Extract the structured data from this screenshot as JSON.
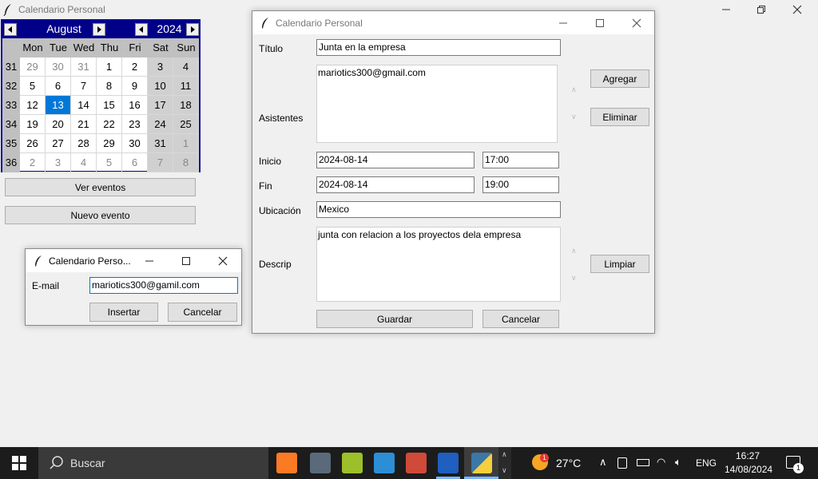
{
  "main_window": {
    "title": "Calendario Personal",
    "controls": {
      "minimize": "—",
      "restore": "❐",
      "close": "✕"
    }
  },
  "calendar": {
    "month": "August",
    "year": "2024",
    "weekdays": [
      "Mon",
      "Tue",
      "Wed",
      "Thu",
      "Fri",
      "Sat",
      "Sun"
    ],
    "weeks": [
      {
        "num": "31",
        "days": [
          "29",
          "30",
          "31",
          "1",
          "2",
          "3",
          "4"
        ]
      },
      {
        "num": "32",
        "days": [
          "5",
          "6",
          "7",
          "8",
          "9",
          "10",
          "11"
        ]
      },
      {
        "num": "33",
        "days": [
          "12",
          "13",
          "14",
          "15",
          "16",
          "17",
          "18"
        ]
      },
      {
        "num": "34",
        "days": [
          "19",
          "20",
          "21",
          "22",
          "23",
          "24",
          "25"
        ]
      },
      {
        "num": "35",
        "days": [
          "26",
          "27",
          "28",
          "29",
          "30",
          "31",
          "1"
        ]
      },
      {
        "num": "36",
        "days": [
          "2",
          "3",
          "4",
          "5",
          "6",
          "7",
          "8"
        ]
      }
    ],
    "selected_day": "13",
    "colors": {
      "header": "#000088",
      "selected": "#0078d7",
      "weekend": "#d0d0d0"
    }
  },
  "main_buttons": {
    "view_events": "Ver eventos",
    "new_event": "Nuevo evento"
  },
  "email_dialog": {
    "title": "Calendario Perso...",
    "email_label": "E-mail",
    "email_value": "mariotics300@gamil.com",
    "insert_button": "Insertar",
    "cancel_button": "Cancelar"
  },
  "event_dialog": {
    "title": "Calendario Personal",
    "title_label": "Título",
    "title_value": "Junta en la empresa",
    "attendees_label": "Asistentes",
    "attendees_value": "mariotics300@gmail.com",
    "add_button": "Agregar",
    "remove_button": "Eliminar",
    "start_label": "Inicio",
    "start_date": "2024-08-14",
    "start_time": "17:00",
    "end_label": "Fin",
    "end_date": "2024-08-14",
    "end_time": "19:00",
    "location_label": "Ubicación",
    "location_value": "Mexico",
    "description_label": "Descrip",
    "description_value": "junta con relacion a los proyectos dela empresa",
    "clear_button": "Limpiar",
    "save_button": "Guardar",
    "cancel_button": "Cancelar"
  },
  "taskbar": {
    "search_placeholder": "Buscar",
    "weather_temp": "27°C",
    "weather_badge": "1",
    "language": "ENG",
    "time": "16:27",
    "date": "14/08/2024",
    "notification_count": "1",
    "icons": [
      "xampp-icon",
      "tools-icon",
      "git-kraken-icon",
      "cloud-icon",
      "git-icon",
      "powershell-icon",
      "python-icon"
    ]
  }
}
